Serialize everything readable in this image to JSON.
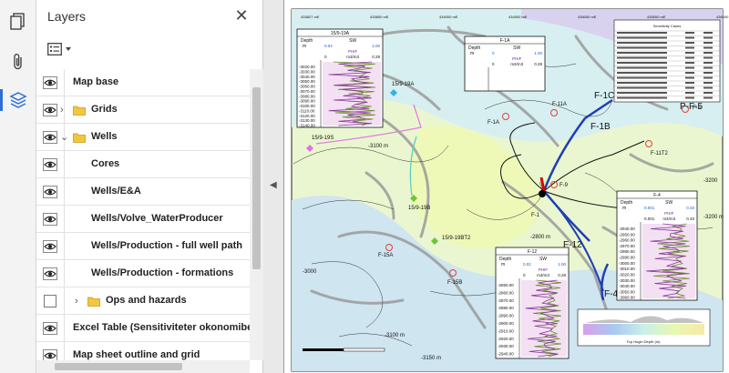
{
  "toolbar": {
    "icons": [
      "pages-icon",
      "attachments-icon",
      "layers-icon"
    ]
  },
  "panel": {
    "title": "Layers",
    "close_label": "✕"
  },
  "layers": [
    {
      "label": "Map base",
      "visible": true,
      "indent": 0,
      "folder": false
    },
    {
      "label": "Grids",
      "visible": true,
      "indent": 0,
      "folder": true,
      "expanded": false
    },
    {
      "label": "Wells",
      "visible": true,
      "indent": 0,
      "folder": true,
      "expanded": true
    },
    {
      "label": "Cores",
      "visible": true,
      "indent": 1,
      "folder": false
    },
    {
      "label": "Wells/E&A",
      "visible": true,
      "indent": 1,
      "folder": false
    },
    {
      "label": "Wells/Volve_WaterProducer",
      "visible": true,
      "indent": 1,
      "folder": false
    },
    {
      "label": "Wells/Production - full well path",
      "visible": true,
      "indent": 1,
      "folder": false
    },
    {
      "label": "Wells/Production - formations",
      "visible": true,
      "indent": 1,
      "folder": false
    },
    {
      "label": "Ops and hazards",
      "visible": false,
      "indent": 1,
      "folder": true,
      "expanded": false
    },
    {
      "label": "Excel Table (Sensitiviteter okonomiber",
      "visible": true,
      "indent": 0,
      "folder": false
    },
    {
      "label": "Map sheet outline and grid",
      "visible": true,
      "indent": 0,
      "folder": false
    }
  ],
  "map": {
    "top_coords": [
      "433827 mE",
      "433800 mE",
      "434000 mE",
      "434500 mE",
      "435000 mE",
      "435500 mE",
      "436000 mE"
    ],
    "wells": [
      "15/9-19A",
      "15/9-19S",
      "15/9-19B",
      "15/9-19BT2",
      "F-15A",
      "F-15B",
      "F-1A",
      "F-11A",
      "F-1C",
      "F-1B",
      "F-5",
      "P-F-5",
      "F-11T2",
      "F-12",
      "F-4",
      "F-9",
      "F-1"
    ],
    "contours": [
      "-3100 m",
      "-2800 m",
      "-3000",
      "-3100 m",
      "-3150 m",
      "-3200",
      "-3200 m"
    ],
    "log_panels": [
      {
        "title": "15/9-19A",
        "col1": "Depth",
        "col2": "SW",
        "unit1": "m",
        "range": [
          "0.04",
          "1.00"
        ],
        "sub": "PHIF",
        "sub_unit": "m3/m3",
        "sub_range": [
          "0",
          "0.28"
        ],
        "depths": [
          "-3020.00",
          "-3030.00",
          "-3040.00",
          "-3050.00",
          "-3060.00",
          "-3070.00",
          "-3080.00",
          "-3090.00",
          "-3100.00",
          "-3110.00",
          "-3120.00",
          "-3130.00",
          "-3140.00"
        ]
      },
      {
        "title": "F-1A",
        "col1": "Depth",
        "col2": "SW",
        "unit1": "m",
        "range": [
          "0",
          "1.00"
        ],
        "sub": "PHIF",
        "sub_unit": "m3/m3",
        "sub_range": [
          "0",
          "0.28"
        ],
        "depths": []
      },
      {
        "title": "F-4",
        "col1": "Depth",
        "col2": "SW",
        "unit1": "m",
        "range": [
          "0.001",
          "0.33"
        ],
        "sub": "PHIF",
        "sub_unit": "m3/m3",
        "sub_range": [
          "0.001",
          "0.33"
        ],
        "depths": [
          "-2940.00",
          "-2950.00",
          "-2960.00",
          "-2970.00",
          "-2980.00",
          "-2990.00",
          "-3000.00",
          "-3010.00",
          "-3020.00",
          "-3030.00",
          "-3040.00",
          "-3050.00",
          "-3060.00"
        ]
      },
      {
        "title": "F-12",
        "col1": "Depth",
        "col2": "SW",
        "unit1": "m",
        "range": [
          "0.02",
          "1.00"
        ],
        "sub": "PHIF",
        "sub_unit": "m3/m3",
        "sub_range": [
          "0",
          "0.28"
        ],
        "depths": [
          "-2850.00",
          "-2860.00",
          "-2870.00",
          "-2880.00",
          "-2890.00",
          "-2900.00",
          "-2910.00",
          "-2920.00",
          "-2930.00",
          "-2940.00"
        ]
      }
    ],
    "table_title": "Sensitivity Cases",
    "colorbar_label": "Top Hugin Depth (m)"
  }
}
